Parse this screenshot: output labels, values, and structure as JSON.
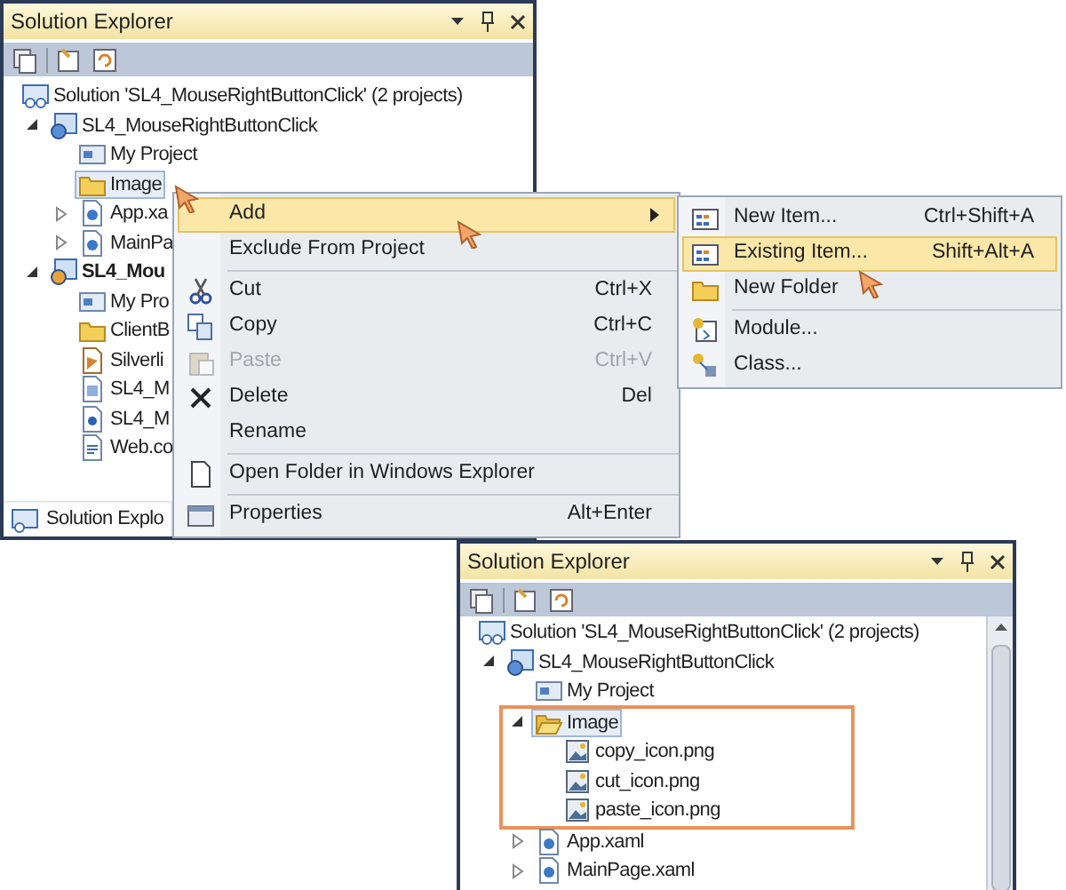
{
  "top_explorer": {
    "title": "Solution Explorer",
    "tree": [
      {
        "label": "Solution 'SL4_MouseRightButtonClick' (2 projects)",
        "kind": "solution",
        "bold": false,
        "selected": false,
        "children": [
          {
            "label": "SL4_MouseRightButtonClick",
            "kind": "project",
            "bold": false,
            "selected": false,
            "expanded": true,
            "children": [
              {
                "label": "My Project",
                "kind": "properties",
                "bold": false,
                "selected": false
              },
              {
                "label": "Image",
                "kind": "folder",
                "bold": false,
                "selected": true
              },
              {
                "label": "App.xa",
                "kind": "xaml",
                "bold": false,
                "selected": false,
                "expanded": false
              },
              {
                "label": "MainPa",
                "kind": "xaml",
                "bold": false,
                "selected": false,
                "expanded": false
              }
            ]
          },
          {
            "label": "SL4_Mou",
            "kind": "web_project",
            "bold": true,
            "selected": false,
            "expanded": true,
            "children": [
              {
                "label": "My Pro",
                "kind": "properties",
                "bold": false,
                "selected": false
              },
              {
                "label": "ClientB",
                "kind": "folder",
                "bold": false,
                "selected": false
              },
              {
                "label": "Silverli",
                "kind": "silverlight",
                "bold": false,
                "selected": false
              },
              {
                "label": "SL4_M",
                "kind": "aspx",
                "bold": false,
                "selected": false
              },
              {
                "label": "SL4_M",
                "kind": "html",
                "bold": false,
                "selected": false
              },
              {
                "label": "Web.co",
                "kind": "config",
                "bold": false,
                "selected": false
              }
            ]
          }
        ]
      }
    ],
    "footer_tab": "Solution Explo"
  },
  "context_menu": {
    "items": [
      {
        "kind": "item",
        "label": "Add",
        "selected": true,
        "disabled": false,
        "submenu": true
      },
      {
        "kind": "item",
        "label": "Exclude From Project",
        "selected": false,
        "disabled": false,
        "submenu": false
      },
      {
        "kind": "separator"
      },
      {
        "kind": "item",
        "label": "Cut",
        "shortcut": "Ctrl+X",
        "selected": false,
        "disabled": false,
        "submenu": false
      },
      {
        "kind": "item",
        "label": "Copy",
        "shortcut": "Ctrl+C",
        "selected": false,
        "disabled": false,
        "submenu": false
      },
      {
        "kind": "item",
        "label": "Paste",
        "shortcut": "Ctrl+V",
        "selected": false,
        "disabled": true,
        "submenu": false
      },
      {
        "kind": "item",
        "label": "Delete",
        "shortcut": "Del",
        "selected": false,
        "disabled": false,
        "submenu": false
      },
      {
        "kind": "item",
        "label": "Rename",
        "selected": false,
        "disabled": false,
        "submenu": false
      },
      {
        "kind": "separator"
      },
      {
        "kind": "item",
        "label": "Open Folder in Windows Explorer",
        "selected": false,
        "disabled": false,
        "submenu": false
      },
      {
        "kind": "separator"
      },
      {
        "kind": "item",
        "label": "Properties",
        "shortcut": "Alt+Enter",
        "selected": false,
        "disabled": false,
        "submenu": false
      }
    ]
  },
  "submenu": {
    "items": [
      {
        "kind": "item",
        "label": "New Item...",
        "shortcut": "Ctrl+Shift+A",
        "selected": false,
        "disabled": false,
        "submenu": false
      },
      {
        "kind": "item",
        "label": "Existing Item...",
        "shortcut": "Shift+Alt+A",
        "selected": true,
        "disabled": false,
        "submenu": false
      },
      {
        "kind": "item",
        "label": "New Folder",
        "selected": false,
        "disabled": false,
        "submenu": false
      },
      {
        "kind": "separator"
      },
      {
        "kind": "item",
        "label": "Module...",
        "selected": false,
        "disabled": false,
        "submenu": false
      },
      {
        "kind": "item",
        "label": "Class...",
        "selected": false,
        "disabled": false,
        "submenu": false
      }
    ]
  },
  "bottom_explorer": {
    "title": "Solution Explorer",
    "tree": [
      {
        "label": "Solution 'SL4_MouseRightButtonClick' (2 projects)",
        "kind": "solution",
        "bold": false,
        "selected": false,
        "children": [
          {
            "label": "SL4_MouseRightButtonClick",
            "kind": "project",
            "bold": false,
            "selected": false,
            "expanded": true,
            "children": [
              {
                "label": "My Project",
                "kind": "properties",
                "bold": false,
                "selected": false
              },
              {
                "label": "Image",
                "kind": "folder_open",
                "bold": false,
                "selected": true,
                "expanded": true,
                "highlighted": true,
                "children": [
                  {
                    "label": "copy_icon.png",
                    "kind": "image",
                    "bold": false,
                    "selected": false
                  },
                  {
                    "label": "cut_icon.png",
                    "kind": "image",
                    "bold": false,
                    "selected": false
                  },
                  {
                    "label": "paste_icon.png",
                    "kind": "image",
                    "bold": false,
                    "selected": false
                  }
                ]
              },
              {
                "label": "App.xaml",
                "kind": "xaml",
                "bold": false,
                "selected": false,
                "expanded": false
              },
              {
                "label": "MainPage.xaml",
                "kind": "xaml",
                "bold": false,
                "selected": false,
                "expanded": false
              }
            ]
          }
        ]
      }
    ]
  }
}
